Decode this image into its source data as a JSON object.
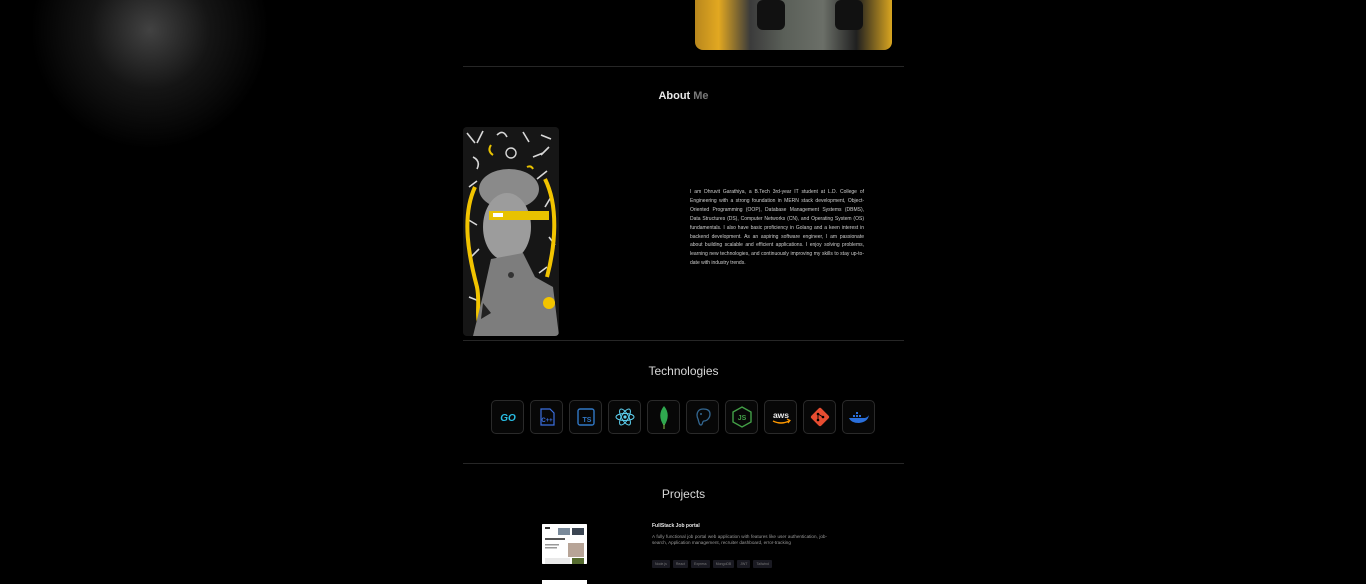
{
  "about": {
    "title_part1": "About",
    "title_part2": "Me",
    "bio": "I am Dhruvit Garathiya, a B.Tech 3rd-year IT student at L.D. College of Engineering with a strong foundation in MERN stack development, Object-Oriented Programming (OOP), Database Management Systems (DBMS), Data Structures (DS), Computer Networks (CN), and Operating System (OS) fundamentals. I also have basic proficiency in Golang and a keen interest in backend development. As an aspiring software engineer, I am passionate about building scalable and efficient applications. I enjoy solving problems, learning new technologies, and continuously improving my skills to stay up-to-date with industry trends."
  },
  "technologies": {
    "title": "Technologies",
    "items": [
      {
        "icon": "golang-icon",
        "label": "GO",
        "color": "#29bfe6"
      },
      {
        "icon": "cpp-icon",
        "label": "C++",
        "color": "#3b6fe0"
      },
      {
        "icon": "typescript-icon",
        "label": "TS",
        "color": "#3178c6"
      },
      {
        "icon": "react-icon",
        "label": "",
        "color": "#5ed3f3"
      },
      {
        "icon": "mongodb-icon",
        "label": "",
        "color": "#2fa84f"
      },
      {
        "icon": "postgresql-icon",
        "label": "",
        "color": "#336791"
      },
      {
        "icon": "nodejs-icon",
        "label": "JS",
        "color": "#43a047"
      },
      {
        "icon": "aws-icon",
        "label": "aws",
        "color": "#e8e8e8"
      },
      {
        "icon": "git-icon",
        "label": "",
        "color": "#e84d31"
      },
      {
        "icon": "docker-icon",
        "label": "",
        "color": "#2a6fdb"
      }
    ]
  },
  "projects": {
    "title": "Projects",
    "items": [
      {
        "title": "FullStack Job portal",
        "description": "A fully functional job portal web application with features like user authentication, job-search, Application management, recruiter dashboard, error-tracking",
        "tags": [
          "Node.js",
          "React",
          "Express",
          "MongoDB",
          "JWT",
          "Tailwind"
        ]
      }
    ]
  }
}
